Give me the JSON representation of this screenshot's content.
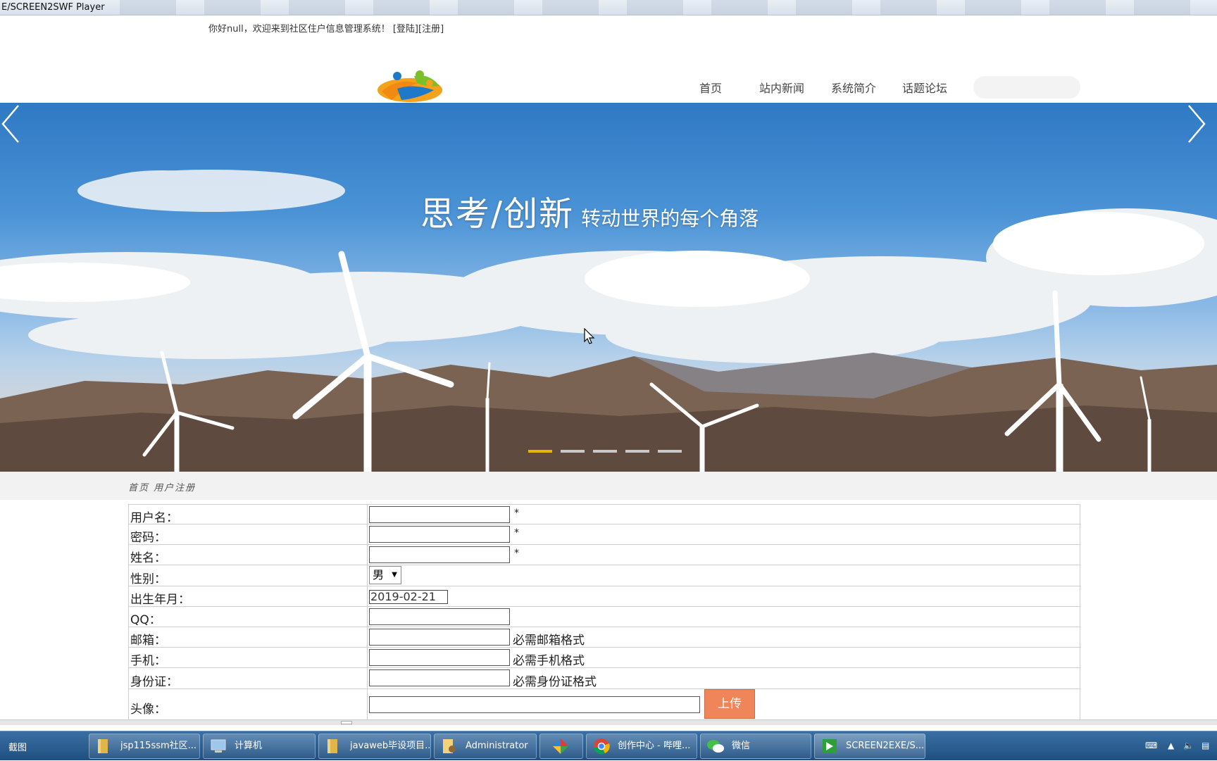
{
  "window": {
    "title": "E/SCREEN2SWF Player"
  },
  "topbar": {
    "greeting": "你好null，欢迎来到社区住户信息管理系统！",
    "login": "[登陆]",
    "register": "[注册]"
  },
  "nav": {
    "items": [
      "首页",
      "站内新闻",
      "系统简介",
      "话题论坛"
    ]
  },
  "banner": {
    "title_big": "思考/创新",
    "title_small": "转动世界的每个角落",
    "slide_count": 5,
    "active_slide": 0
  },
  "breadcrumb": "首页 用户注册",
  "form": {
    "username_label": "用户名：",
    "password_label": "密码：",
    "name_label": "姓名：",
    "gender_label": "性别：",
    "gender_value": "男",
    "birth_label": "出生年月：",
    "birth_value": "2019-02-21",
    "qq_label": "QQ：",
    "email_label": "邮箱：",
    "email_hint": "必需邮箱格式",
    "phone_label": "手机：",
    "phone_hint": "必需手机格式",
    "idcard_label": "身份证：",
    "idcard_hint": "必需身份证格式",
    "avatar_label": "头像：",
    "upload_label": "上传",
    "required_mark": "*"
  },
  "taskbar": {
    "start": "截图",
    "items": [
      "jsp115ssm社区...",
      "计算机",
      "javaweb毕设项目...",
      "Administrator",
      "",
      "创作中心 - 哔哩...",
      "微信",
      "SCREEN2EXE/S..."
    ]
  },
  "colors": {
    "accent_yellow": "#e5c400",
    "upload_orange": "#f0855a"
  }
}
